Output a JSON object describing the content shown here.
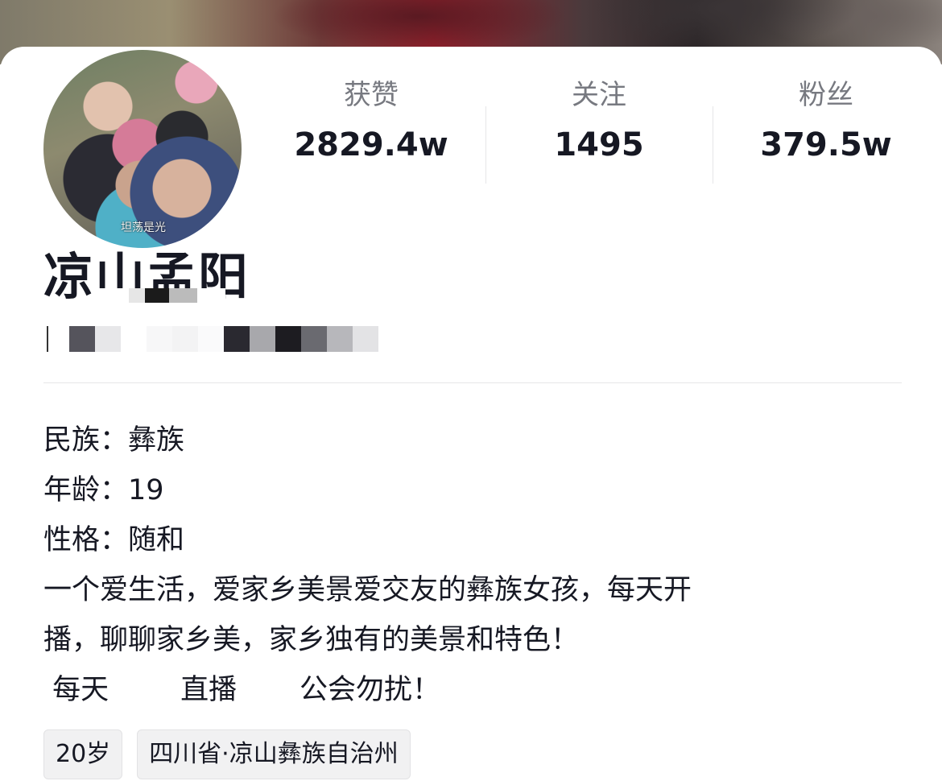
{
  "profile": {
    "name": "凉山孟阳",
    "avatar_caption": "坦荡是光"
  },
  "stats": [
    {
      "label": "获赞",
      "value": "2829.4w"
    },
    {
      "label": "关注",
      "value": "1495"
    },
    {
      "label": "粉丝",
      "value": "379.5w"
    }
  ],
  "bio": {
    "lines": [
      "民族：彝族",
      "年龄：19",
      "性格：随和",
      "一个爱生活，爱家乡美景爱交友的彝族女孩，每天开",
      "播，聊聊家乡美，家乡独有的美景和特色！",
      " 每天        直播       公会勿扰！"
    ]
  },
  "tags": [
    {
      "label": "20岁"
    },
    {
      "label": "四川省·凉山彝族自治州"
    }
  ],
  "colors": {
    "text_primary": "#161823",
    "text_secondary": "#777980",
    "tag_bg": "#f1f1f2",
    "divider": "#e6e6e8"
  }
}
